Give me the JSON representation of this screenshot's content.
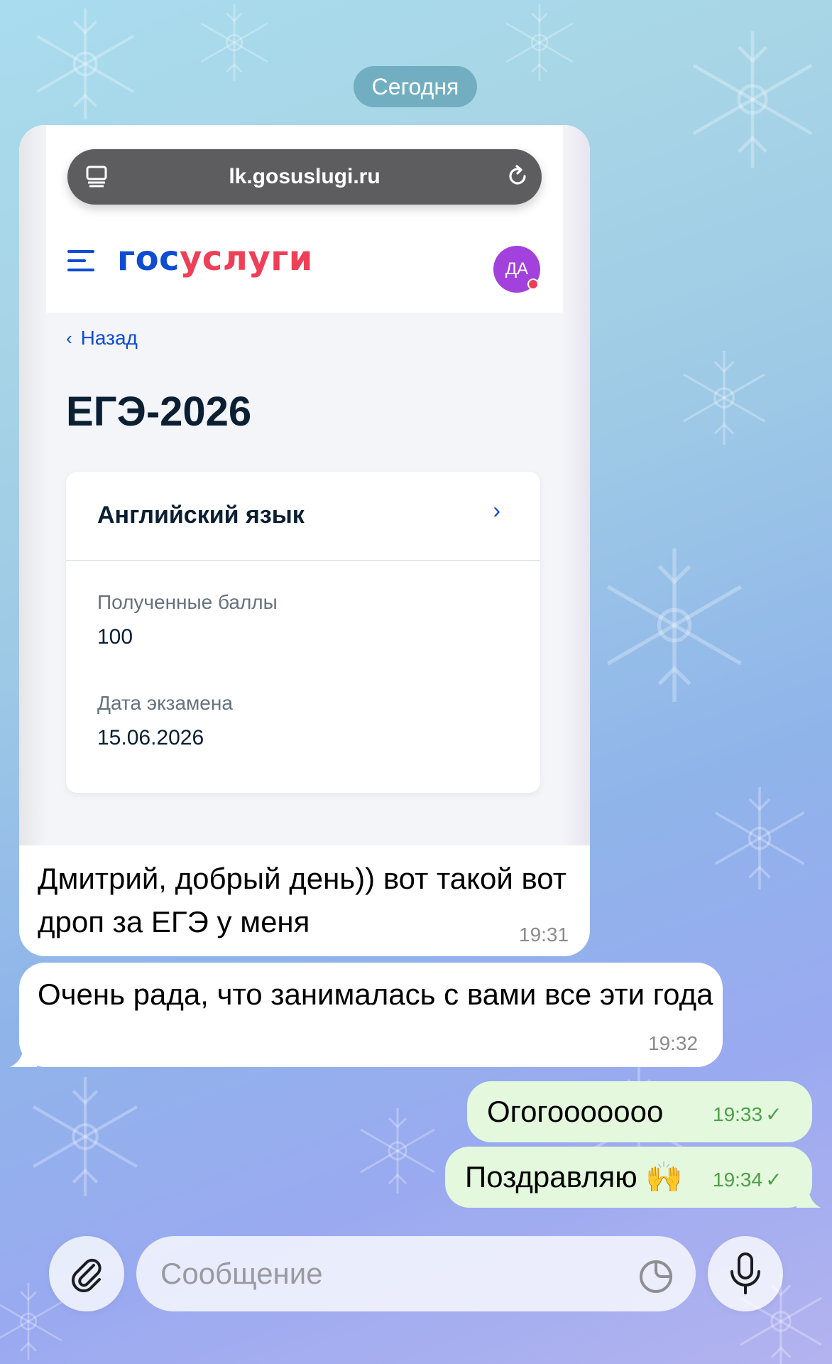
{
  "chat": {
    "date_label": "Сегодня",
    "messages": [
      {
        "text": "Дмитрий, добрый день)) вот такой вот дроп за ЕГЭ у меня",
        "time": "19:31",
        "screenshot": {
          "browser_url": "lk.gosuslugi.ru",
          "logo_part1": "гос",
          "logo_part2": "услуги",
          "avatar_initials": "ДА",
          "back_label": "Назад",
          "page_title": "ЕГЭ-2026",
          "card": {
            "title": "Английский язык",
            "score_label": "Полученные баллы",
            "score_value": "100",
            "date_label": "Дата экзамена",
            "date_value": "15.06.2026"
          }
        }
      },
      {
        "text": "Очень рада, что занималась с вами все эти года",
        "time": "19:32"
      },
      {
        "text": "Огогооооооо",
        "time": "19:33",
        "check": "✓"
      },
      {
        "text": "Поздравляю 🙌",
        "time": "19:34",
        "check": "✓"
      }
    ]
  },
  "composer": {
    "placeholder": "Сообщение",
    "attach_icon": "paperclip-icon",
    "sticker_icon": "sticker-icon",
    "mic_icon": "microphone-icon"
  },
  "colors": {
    "incoming_bubble": "#ffffff",
    "outgoing_bubble": "#e3f8dd",
    "outgoing_time": "#4f9f4b",
    "gosuslugi_blue": "#0d4cd3",
    "gosuslugi_red": "#ee3f58",
    "avatar": "#a341dd"
  }
}
